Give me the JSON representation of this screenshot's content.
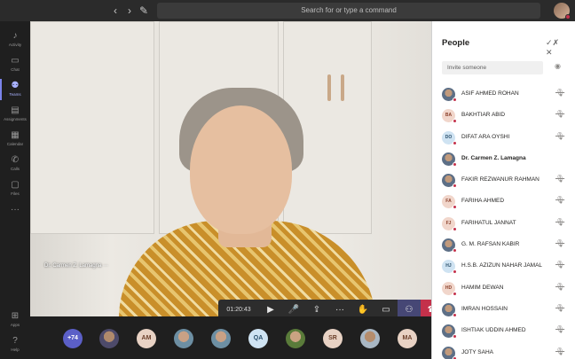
{
  "topbar": {
    "back_icon": "‹",
    "forward_icon": "›",
    "compose_icon": "✎",
    "search_placeholder": "Search for or type a command"
  },
  "rail": [
    {
      "icon": "♪",
      "label": "Activity"
    },
    {
      "icon": "▭",
      "label": "Chat"
    },
    {
      "icon": "⚉",
      "label": "Teams",
      "active": true
    },
    {
      "icon": "▤",
      "label": "Assignments"
    },
    {
      "icon": "▦",
      "label": "Calendar"
    },
    {
      "icon": "✆",
      "label": "Calls"
    },
    {
      "icon": "▢",
      "label": "Files"
    },
    {
      "icon": "···",
      "label": ""
    }
  ],
  "rail_bottom": [
    {
      "icon": "⊞",
      "label": "Apps"
    },
    {
      "icon": "?",
      "label": "Help"
    }
  ],
  "stage": {
    "speaker_name": "Dr. Carmen Z. Lamagna",
    "speaker_more": "···"
  },
  "controls": {
    "timer": "01:20:43",
    "video_icon": "▶",
    "mic_icon": "🎤",
    "share_icon": "⇪",
    "more_icon": "···",
    "raise_hand_icon": "✋",
    "chat_icon": "▭",
    "participants_icon": "⚇",
    "hangup_icon": "☎"
  },
  "strip": {
    "more_count": "+74",
    "participants": [
      {
        "kind": "photo",
        "style": ""
      },
      {
        "kind": "init",
        "text": "AM",
        "style": ""
      },
      {
        "kind": "photo",
        "style": "b"
      },
      {
        "kind": "photo",
        "style": "b"
      },
      {
        "kind": "init",
        "text": "QA",
        "style": "blue"
      },
      {
        "kind": "photo",
        "style": "c"
      },
      {
        "kind": "init",
        "text": "SR",
        "style": ""
      },
      {
        "kind": "photo",
        "style": "d"
      },
      {
        "kind": "init",
        "text": "MA",
        "style": ""
      }
    ]
  },
  "panel": {
    "title": "People",
    "mute_all_icon": "✓✗",
    "close_icon": "✕",
    "invite_placeholder": "Invite someone",
    "eye_icon": "◉",
    "people": [
      {
        "name": "ASIF AHMED ROHAN",
        "avatar": "",
        "avatar_kind": "photo",
        "muted": true,
        "bold": false
      },
      {
        "name": "BAKHTIAR ABID",
        "avatar": "BA",
        "avatar_kind": "init",
        "muted": true,
        "bold": false
      },
      {
        "name": "DIFAT ARA OYSHI",
        "avatar": "DO",
        "avatar_kind": "init-blue",
        "muted": true,
        "bold": false
      },
      {
        "name": "Dr. Carmen Z. Lamagna",
        "avatar": "",
        "avatar_kind": "photo",
        "muted": false,
        "bold": true
      },
      {
        "name": "FAKIR REZWANUR RAHMAN",
        "avatar": "",
        "avatar_kind": "photo",
        "muted": true,
        "bold": false
      },
      {
        "name": "FARIHA AHMED",
        "avatar": "FA",
        "avatar_kind": "init",
        "muted": true,
        "bold": false
      },
      {
        "name": "FARIHATUL JANNAT",
        "avatar": "FJ",
        "avatar_kind": "init",
        "muted": true,
        "bold": false
      },
      {
        "name": "G. M. RAFSAN KABIR",
        "avatar": "",
        "avatar_kind": "photo",
        "muted": true,
        "bold": false
      },
      {
        "name": "H.S.B. AZIZUN NAHAR JAMAL",
        "avatar": "HJ",
        "avatar_kind": "init-blue",
        "muted": true,
        "bold": false
      },
      {
        "name": "HAMIM DEWAN",
        "avatar": "HD",
        "avatar_kind": "init",
        "muted": true,
        "bold": false
      },
      {
        "name": "IMRAN HOSSAIN",
        "avatar": "",
        "avatar_kind": "photo",
        "muted": true,
        "bold": false
      },
      {
        "name": "ISHTIAK UDDIN AHMED",
        "avatar": "",
        "avatar_kind": "photo",
        "muted": true,
        "bold": false
      },
      {
        "name": "JOTY SAHA",
        "avatar": "",
        "avatar_kind": "photo",
        "muted": true,
        "bold": false
      }
    ]
  },
  "colors": {
    "accent": "#5b5fc7",
    "hangup": "#c4314b",
    "chrome": "#2b2b2b"
  }
}
